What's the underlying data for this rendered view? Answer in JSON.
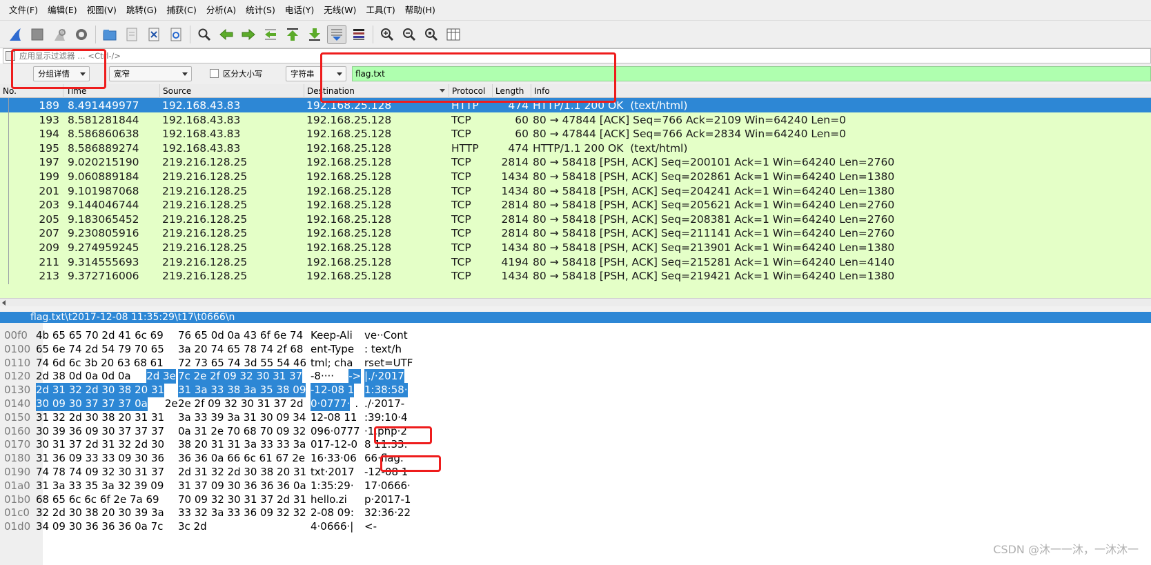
{
  "menu": [
    "文件(F)",
    "编辑(E)",
    "视图(V)",
    "跳转(G)",
    "捕获(C)",
    "分析(A)",
    "统计(S)",
    "电话(Y)",
    "无线(W)",
    "工具(T)",
    "帮助(H)"
  ],
  "toolbar_icons": [
    "shark-fin-icon",
    "stop-icon",
    "restart-icon",
    "options-gear-icon",
    "open-folder-icon",
    "file-icon",
    "close-file-icon",
    "reload-icon",
    "find-icon",
    "back-arrow-icon",
    "forward-arrow-icon",
    "go-to-packet-icon",
    "first-packet-icon",
    "last-packet-icon",
    "autoscroll-icon",
    "colorize-icon",
    "zoom-in-icon",
    "zoom-out-icon",
    "zoom-normal-icon",
    "resize-columns-icon"
  ],
  "filter": {
    "placeholder": "应用显示过滤器 … <Ctrl-/>"
  },
  "find": {
    "search_in": "分组详情",
    "charset": "宽窄",
    "case_label": "区分大小写",
    "search_type": "字符串",
    "search_value": "flag.txt"
  },
  "columns": {
    "no": "No.",
    "time": "Time",
    "source": "Source",
    "destination": "Destination",
    "protocol": "Protocol",
    "length": "Length",
    "info": "Info"
  },
  "packets": [
    {
      "no": "189",
      "time": "8.491449977",
      "src": "192.168.43.83",
      "dst": "192.168.25.128",
      "proto": "HTTP",
      "len": "474",
      "info": "HTTP/1.1 200 OK  (text/html)"
    },
    {
      "no": "193",
      "time": "8.581281844",
      "src": "192.168.43.83",
      "dst": "192.168.25.128",
      "proto": "TCP",
      "len": "60",
      "info": "80 → 47844 [ACK] Seq=766 Ack=2109 Win=64240 Len=0"
    },
    {
      "no": "194",
      "time": "8.586860638",
      "src": "192.168.43.83",
      "dst": "192.168.25.128",
      "proto": "TCP",
      "len": "60",
      "info": "80 → 47844 [ACK] Seq=766 Ack=2834 Win=64240 Len=0"
    },
    {
      "no": "195",
      "time": "8.586889274",
      "src": "192.168.43.83",
      "dst": "192.168.25.128",
      "proto": "HTTP",
      "len": "474",
      "info": "HTTP/1.1 200 OK  (text/html)"
    },
    {
      "no": "197",
      "time": "9.020215190",
      "src": "219.216.128.25",
      "dst": "192.168.25.128",
      "proto": "TCP",
      "len": "2814",
      "info": "80 → 58418 [PSH, ACK] Seq=200101 Ack=1 Win=64240 Len=2760"
    },
    {
      "no": "199",
      "time": "9.060889184",
      "src": "219.216.128.25",
      "dst": "192.168.25.128",
      "proto": "TCP",
      "len": "1434",
      "info": "80 → 58418 [PSH, ACK] Seq=202861 Ack=1 Win=64240 Len=1380"
    },
    {
      "no": "201",
      "time": "9.101987068",
      "src": "219.216.128.25",
      "dst": "192.168.25.128",
      "proto": "TCP",
      "len": "1434",
      "info": "80 → 58418 [PSH, ACK] Seq=204241 Ack=1 Win=64240 Len=1380"
    },
    {
      "no": "203",
      "time": "9.144046744",
      "src": "219.216.128.25",
      "dst": "192.168.25.128",
      "proto": "TCP",
      "len": "2814",
      "info": "80 → 58418 [PSH, ACK] Seq=205621 Ack=1 Win=64240 Len=2760"
    },
    {
      "no": "205",
      "time": "9.183065452",
      "src": "219.216.128.25",
      "dst": "192.168.25.128",
      "proto": "TCP",
      "len": "2814",
      "info": "80 → 58418 [PSH, ACK] Seq=208381 Ack=1 Win=64240 Len=2760"
    },
    {
      "no": "207",
      "time": "9.230805916",
      "src": "219.216.128.25",
      "dst": "192.168.25.128",
      "proto": "TCP",
      "len": "2814",
      "info": "80 → 58418 [PSH, ACK] Seq=211141 Ack=1 Win=64240 Len=2760"
    },
    {
      "no": "209",
      "time": "9.274959245",
      "src": "219.216.128.25",
      "dst": "192.168.25.128",
      "proto": "TCP",
      "len": "1434",
      "info": "80 → 58418 [PSH, ACK] Seq=213901 Ack=1 Win=64240 Len=1380"
    },
    {
      "no": "211",
      "time": "9.314555693",
      "src": "219.216.128.25",
      "dst": "192.168.25.128",
      "proto": "TCP",
      "len": "4194",
      "info": "80 → 58418 [PSH, ACK] Seq=215281 Ack=1 Win=64240 Len=4140"
    },
    {
      "no": "213",
      "time": "9.372716006",
      "src": "219.216.128.25",
      "dst": "192.168.25.128",
      "proto": "TCP",
      "len": "1434",
      "info": "80 → 58418 [PSH, ACK] Seq=219421 Ack=1 Win=64240 Len=1380"
    }
  ],
  "detail_text": "flag.txt\\t2017-12-08 11:35:29\\t17\\t0666\\n",
  "bytes": [
    {
      "off": "00f0",
      "hex1": "4b 65 65 70 2d 41 6c 69",
      "hex2": "76 65 0d 0a 43 6f 6e 74",
      "ascii1": "Keep-Ali",
      "ascii2": "ve··Cont"
    },
    {
      "off": "0100",
      "hex1": "65 6e 74 2d 54 79 70 65",
      "hex2": "3a 20 74 65 78 74 2f 68",
      "ascii1": "ent-Type",
      "ascii2": ": text/h"
    },
    {
      "off": "0110",
      "hex1": "74 6d 6c 3b 20 63 68 61",
      "hex2": "72 73 65 74 3d 55 54 46",
      "ascii1": "tml; cha",
      "ascii2": "rset=UTF"
    },
    {
      "off": "0120",
      "hex1": "2d 38 0d 0a 0d 0a",
      "hex1hl": "2d 3e",
      "hex2": "7c 2e 2f 09 32 30 31 37",
      "ascii1": "-8····",
      "ascii1hl": "->",
      "ascii2": "|./·2017",
      "hl2": true
    },
    {
      "off": "0130",
      "hex1": "",
      "hex1hl": "2d 31 32 2d 30 38 20 31",
      "hex2": "31 3a 33 38 3a 35 38 09",
      "ascii1": "",
      "ascii1hl": "-12-08 1",
      "ascii2": "1:38:58·",
      "hl2": true
    },
    {
      "off": "0140",
      "hex1": "",
      "hex1hl": "30 09 30 37 37 37 0a",
      "hex1rest": "2e",
      "hex2": "2e 2f 09 32 30 31 37 2d",
      "ascii1": "",
      "ascii1hl": "0·0777·",
      "ascii1rest": ".",
      "ascii2": "./·2017-",
      "hl2": false
    },
    {
      "off": "0150",
      "hex1": "31 32 2d 30 38 20 31 31",
      "hex2": "3a 33 39 3a 31 30 09 34",
      "ascii1": "12-08 11",
      "ascii2": ":39:10·4"
    },
    {
      "off": "0160",
      "hex1": "30 39 36 09 30 37 37 37",
      "hex2": "0a 31 2e 70 68 70 09 32",
      "ascii1": "096·0777",
      "ascii2": "·1.php·2"
    },
    {
      "off": "0170",
      "hex1": "30 31 37 2d 31 32 2d 30",
      "hex2": "38 20 31 31 3a 33 33 3a",
      "ascii1": "017-12-0",
      "ascii2": "8 11:33:"
    },
    {
      "off": "0180",
      "hex1": "31 36 09 33 33 09 30 36",
      "hex2": "36 36 0a 66 6c 61 67 2e",
      "ascii1": "16·33·06",
      "ascii2": "66·flag."
    },
    {
      "off": "0190",
      "hex1": "74 78 74 09 32 30 31 37",
      "hex2": "2d 31 32 2d 30 38 20 31",
      "ascii1": "txt·2017",
      "ascii2": "-12-08 1"
    },
    {
      "off": "01a0",
      "hex1": "31 3a 33 35 3a 32 39 09",
      "hex2": "31 37 09 30 36 36 36 0a",
      "ascii1": "1:35:29·",
      "ascii2": "17·0666·"
    },
    {
      "off": "01b0",
      "hex1": "68 65 6c 6c 6f 2e 7a 69",
      "hex2": "70 09 32 30 31 37 2d 31",
      "ascii1": "hello.zi",
      "ascii2": "p·2017-1"
    },
    {
      "off": "01c0",
      "hex1": "32 2d 30 38 20 30 39 3a",
      "hex2": "33 32 3a 33 36 09 32 32",
      "ascii1": "2-08 09:",
      "ascii2": "32:36·22"
    },
    {
      "off": "01d0",
      "hex1": "34 09 30 36 36 36 0a 7c",
      "hex2": "3c 2d",
      "ascii1": "4·0666·|",
      "ascii2": "<-"
    }
  ],
  "watermark": "CSDN @沐一一沐，一沐沐一",
  "colors": {
    "selected_row": "#2d87d5",
    "http_row": "#e4ffc7",
    "find_input": "#afffaf",
    "annotation_box": "#ee1c1c"
  }
}
